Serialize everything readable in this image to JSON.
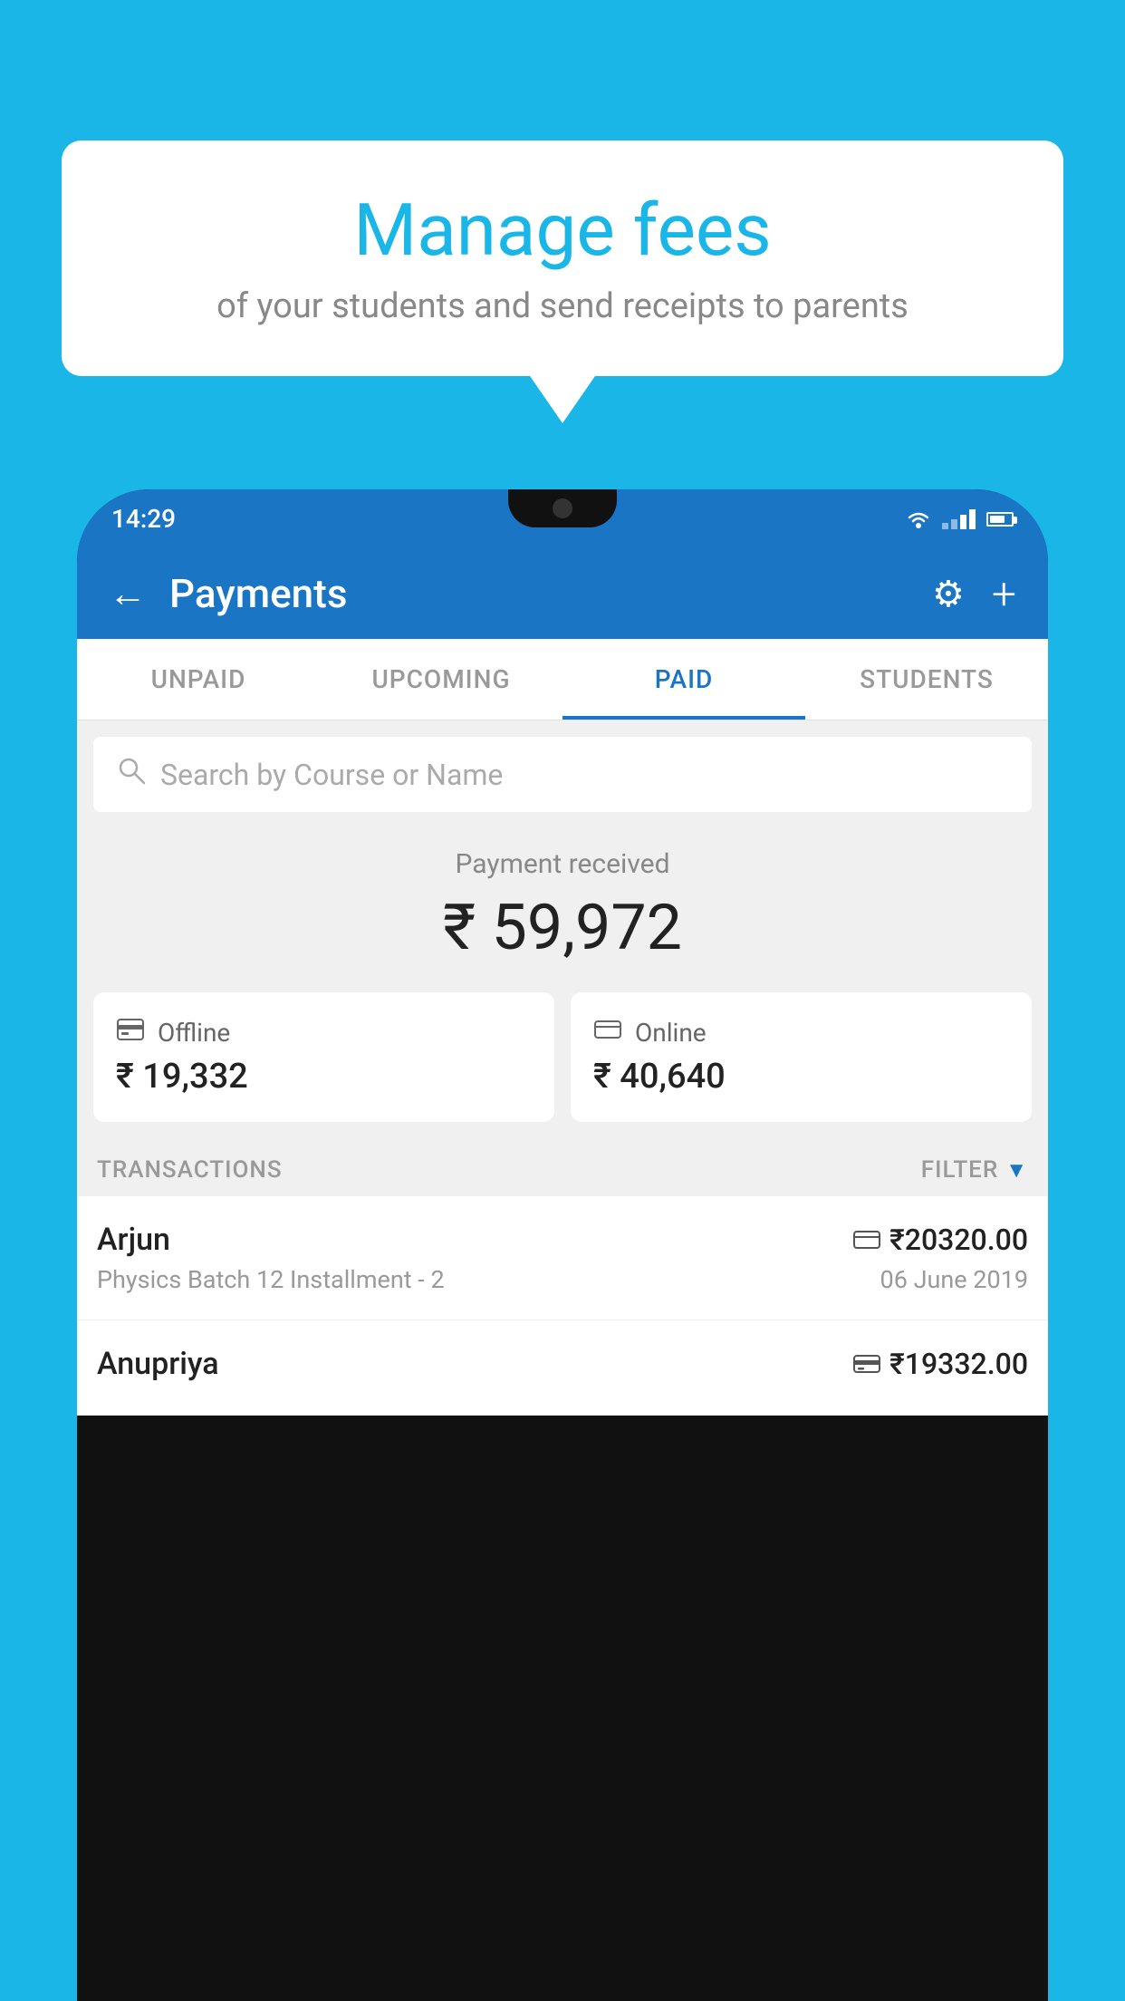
{
  "background_color": "#1ab6e8",
  "speech_bubble": {
    "title": "Manage fees",
    "subtitle": "of your students and send receipts to parents"
  },
  "phone": {
    "status_bar": {
      "time": "14:29"
    },
    "header": {
      "title": "Payments",
      "back_label": "←",
      "settings_label": "⚙",
      "add_label": "+"
    },
    "tabs": [
      {
        "label": "UNPAID",
        "active": false
      },
      {
        "label": "UPCOMING",
        "active": false
      },
      {
        "label": "PAID",
        "active": true
      },
      {
        "label": "STUDENTS",
        "active": false
      }
    ],
    "search": {
      "placeholder": "Search by Course or Name"
    },
    "payment_section": {
      "label": "Payment received",
      "amount": "₹ 59,972",
      "offline": {
        "label": "Offline",
        "amount": "₹ 19,332"
      },
      "online": {
        "label": "Online",
        "amount": "₹ 40,640"
      }
    },
    "transactions": {
      "header_label": "TRANSACTIONS",
      "filter_label": "FILTER",
      "items": [
        {
          "name": "Arjun",
          "amount": "₹20320.00",
          "course": "Physics Batch 12 Installment - 2",
          "date": "06 June 2019",
          "payment_type": "online"
        },
        {
          "name": "Anupriya",
          "amount": "₹19332.00",
          "course": "",
          "date": "",
          "payment_type": "offline"
        }
      ]
    }
  }
}
